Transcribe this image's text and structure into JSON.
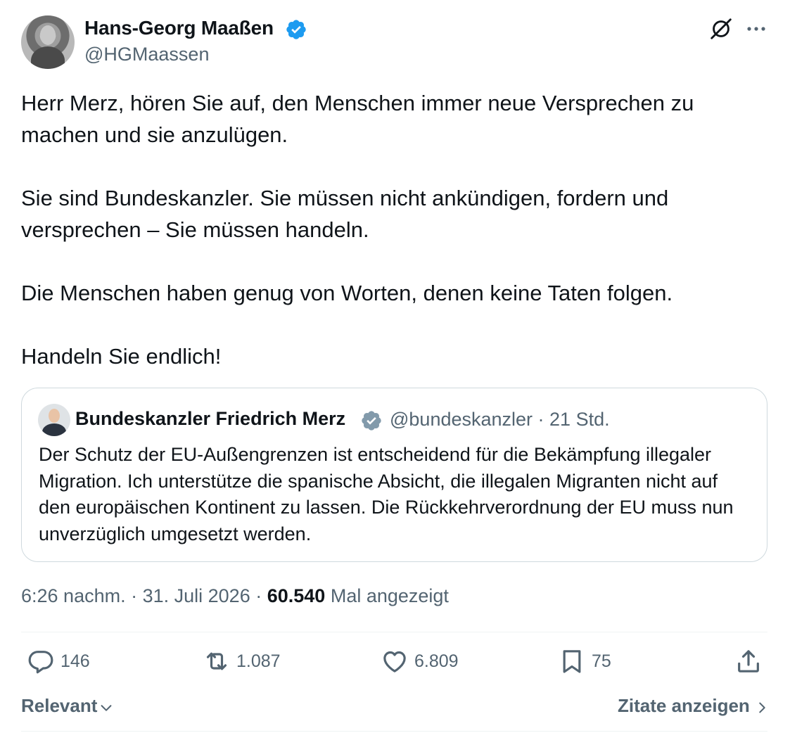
{
  "author": {
    "name": "Hans-Georg Maaßen",
    "handle": "@HGMaassen",
    "verified_color": "#1d9bf0"
  },
  "post": {
    "paragraphs": [
      "Herr Merz, hören Sie auf, den Menschen immer neue Versprechen zu machen und sie anzulügen.",
      "Sie sind Bundeskanzler. Sie müssen nicht ankündigen, fordern und versprechen – Sie müssen handeln.",
      "Die Menschen haben genug von Worten, denen keine Taten folgen.",
      "Handeln Sie endlich!"
    ]
  },
  "quoted": {
    "name": "Bundeskanzler Friedrich Merz",
    "handle": "@bundeskanzler",
    "time": "21 Std.",
    "verified_color": "#829aab",
    "text": "Der Schutz der EU-Außengrenzen ist entscheidend für die Bekämpfung illegaler Migration. Ich unterstütze die spanische Absicht, die illegalen Migranten nicht auf den europäischen Kontinent zu lassen. Die Rückkehrverordnung der EU muss nun unverzüglich umgesetzt werden."
  },
  "meta": {
    "time": "6:26 nachm.",
    "date": "31. Juli 2026",
    "views": "60.540",
    "views_label": "Mal angezeigt"
  },
  "actions": {
    "replies": "146",
    "reposts": "1.087",
    "likes": "6.809",
    "bookmarks": "75"
  },
  "footer": {
    "sort_label": "Relevant",
    "quotes_label": "Zitate anzeigen"
  },
  "icons": [
    "verified-badge-icon",
    "grok-icon",
    "more-icon",
    "reply-icon",
    "repost-icon",
    "like-icon",
    "bookmark-icon",
    "share-icon",
    "chevron-down-icon",
    "chevron-right-icon"
  ]
}
